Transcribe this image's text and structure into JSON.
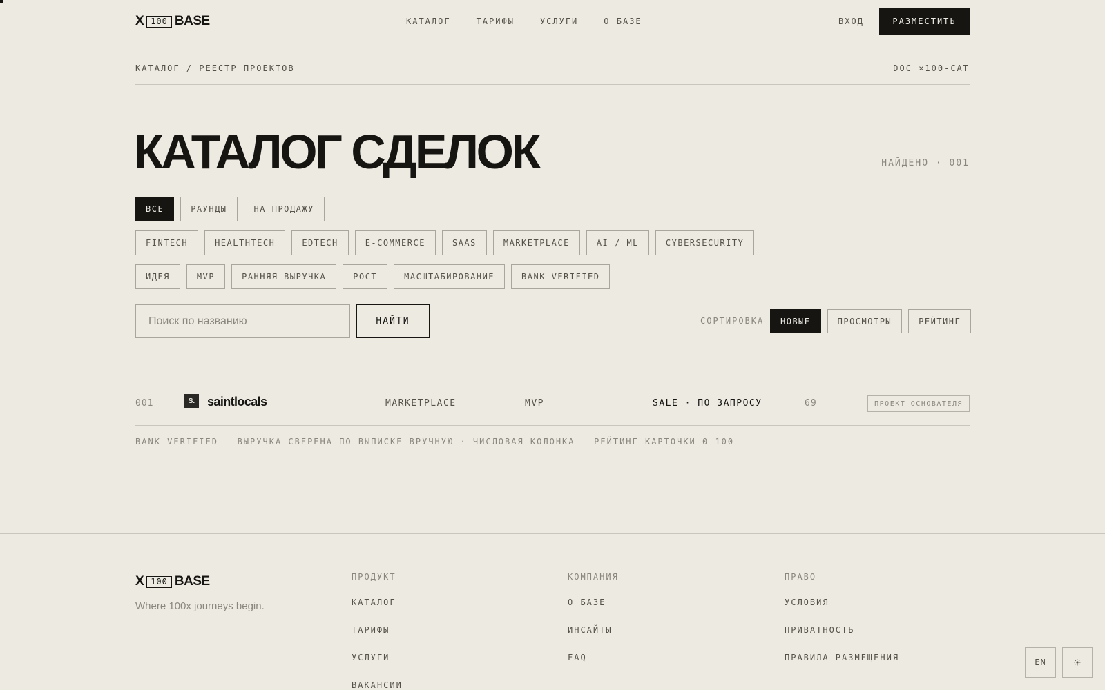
{
  "brand": {
    "logo_left": "X",
    "logo_box": "100",
    "logo_right": "BASE"
  },
  "nav": {
    "items": [
      "КАТАЛОГ",
      "ТАРИФЫ",
      "УСЛУГИ",
      "О БАЗЕ"
    ],
    "login": "ВХОД",
    "place_button": "РАЗМЕСТИТЬ"
  },
  "breadcrumb": "КАТАЛОГ / РЕЕСТР ПРОЕКТОВ",
  "doc_code": "DOC ×100-CAT",
  "page_title": "КАТАЛОГ СДЕЛОК",
  "found": "НАЙДЕНО · 001",
  "filters": {
    "type": [
      "ВСЕ",
      "РАУНДЫ",
      "НА ПРОДАЖУ"
    ],
    "type_active": "ВСЕ",
    "industry": [
      "FINTECH",
      "HEALTHTECH",
      "EDTECH",
      "E-COMMERCE",
      "SAAS",
      "MARKETPLACE",
      "AI / ML",
      "CYBERSECURITY"
    ],
    "stage": [
      "ИДЕЯ",
      "MVP",
      "РАННЯЯ ВЫРУЧКА",
      "РОСТ",
      "МАСШТАБИРОВАНИЕ",
      "BANK VERIFIED"
    ]
  },
  "search": {
    "placeholder": "Поиск по названию",
    "value": "",
    "button": "НАЙТИ"
  },
  "sort": {
    "label": "СОРТИРОВКА",
    "options": [
      "НОВЫЕ",
      "ПРОСМОТРЫ",
      "РЕЙТИНГ"
    ],
    "active": "НОВЫЕ"
  },
  "results": [
    {
      "num": "001",
      "logo_text": "S.",
      "name": "saintlocals",
      "category": "MARKETPLACE",
      "stage": "MVP",
      "deal": "SALE · ПО ЗАПРОСУ",
      "score": "69",
      "badge": "ПРОЕКТ ОСНОВАТЕЛЯ"
    }
  ],
  "footnote": "BANK VERIFIED — ВЫРУЧКА СВЕРЕНА ПО ВЫПИСКЕ ВРУЧНУЮ · ЧИСЛОВАЯ КОЛОНКА — РЕЙТИНГ КАРТОЧКИ 0–100",
  "footer": {
    "tagline": "Where 100x journeys begin.",
    "columns": [
      {
        "heading": "ПРОДУКТ",
        "links": [
          "КАТАЛОГ",
          "ТАРИФЫ",
          "УСЛУГИ",
          "ВАКАНСИИ"
        ]
      },
      {
        "heading": "КОМПАНИЯ",
        "links": [
          "О БАЗЕ",
          "ИНСАЙТЫ",
          "FAQ"
        ]
      },
      {
        "heading": "ПРАВО",
        "links": [
          "УСЛОВИЯ",
          "ПРИВАТНОСТЬ",
          "ПРАВИЛА РАЗМЕЩЕНИЯ"
        ]
      }
    ],
    "lang_button": "EN",
    "theme_icon": "sun-icon"
  },
  "colors": {
    "background": "#edeae2",
    "ink": "#161512",
    "muted": "#8a877e",
    "border": "#a9a69d"
  }
}
